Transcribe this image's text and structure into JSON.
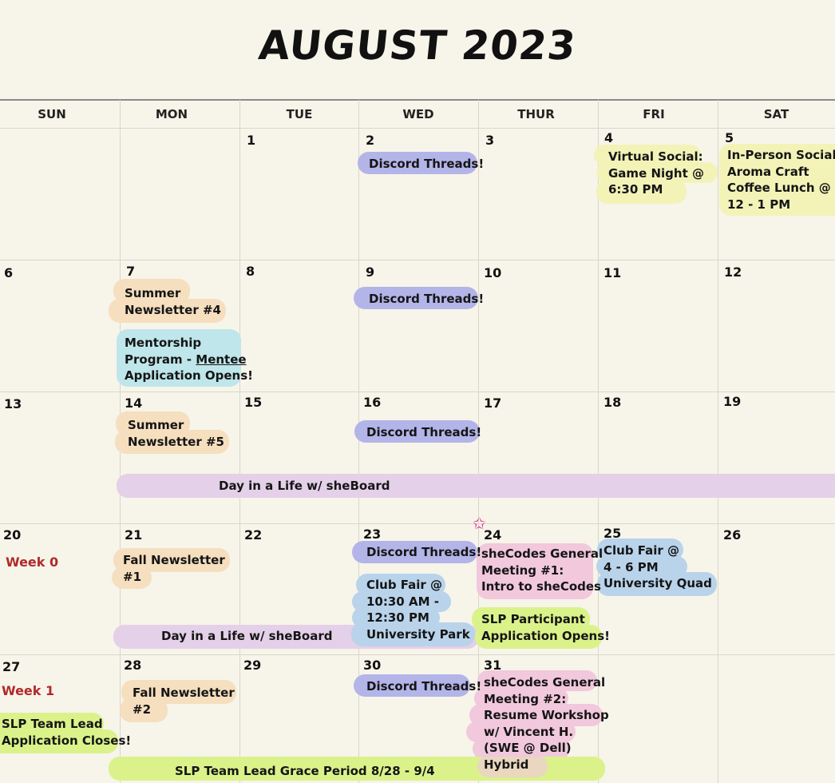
{
  "title": "AUGUST 2023",
  "days": [
    "SUN",
    "MON",
    "TUE",
    "WED",
    "THUR",
    "FRI",
    "SAT"
  ],
  "dates": [
    "1",
    "2",
    "3",
    "4",
    "5",
    "6",
    "7",
    "8",
    "9",
    "10",
    "11",
    "12",
    "13",
    "14",
    "15",
    "16",
    "17",
    "18",
    "19",
    "20",
    "21",
    "22",
    "23",
    "24",
    "25",
    "26",
    "27",
    "28",
    "29",
    "30",
    "31"
  ],
  "weeks": {
    "w0": "Week 0",
    "w1": "Week 1"
  },
  "events": {
    "discord": "Discord Threads!",
    "virtual_social": [
      "Virtual Social:",
      "Game Night @",
      "6:30 PM"
    ],
    "inperson_social": [
      "In-Person Social:",
      "Aroma Craft",
      "Coffee Lunch @",
      "12 - 1 PM"
    ],
    "summer4": [
      "Summer",
      "Newsletter #4"
    ],
    "mentorship": {
      "l1": "Mentorship",
      "l2a": "Program - ",
      "l2b": "Mentee",
      "l3": "Application Opens!"
    },
    "summer5": [
      "Summer",
      "Newsletter #5"
    ],
    "day_in_life": "Day in a Life w/ sheBoard",
    "fall1": [
      "Fall Newsletter",
      "#1"
    ],
    "club_fair_wed": [
      "Club Fair @",
      "10:30 AM -",
      "12:30 PM",
      "University Park"
    ],
    "gm1": [
      "sheCodes General",
      "Meeting #1:",
      "Intro to sheCodes"
    ],
    "slp_participant": [
      "SLP Participant",
      "Application Opens!"
    ],
    "club_fair_fri": [
      "Club Fair @",
      "4 - 6 PM",
      "University Quad"
    ],
    "slp_team_lead": [
      "SLP Team Lead",
      "Application Closes!"
    ],
    "fall2": [
      "Fall Newsletter",
      "#2"
    ],
    "gm2": [
      "sheCodes General",
      "Meeting #2:",
      "Resume Workshop",
      "w/ Vincent H.",
      "(SWE @ Dell)",
      "Hybrid"
    ],
    "grace_period": "SLP Team Lead Grace Period 8/28 - 9/4"
  },
  "colors": {
    "background": "#f7f4ea",
    "discord": "#b3b4e8",
    "social": "#f3f3b8",
    "newsletter": "#f5dfbf",
    "mentorship": "#bfe6ea",
    "club_fair": "#b9d3ea",
    "general_meeting": "#f1c8dc",
    "slp": "#dbf28a",
    "day_in_life": "#e4d0e8",
    "week_label": "#b02a2a",
    "star": "#e0358f"
  },
  "icons": {
    "star": "star-icon"
  }
}
